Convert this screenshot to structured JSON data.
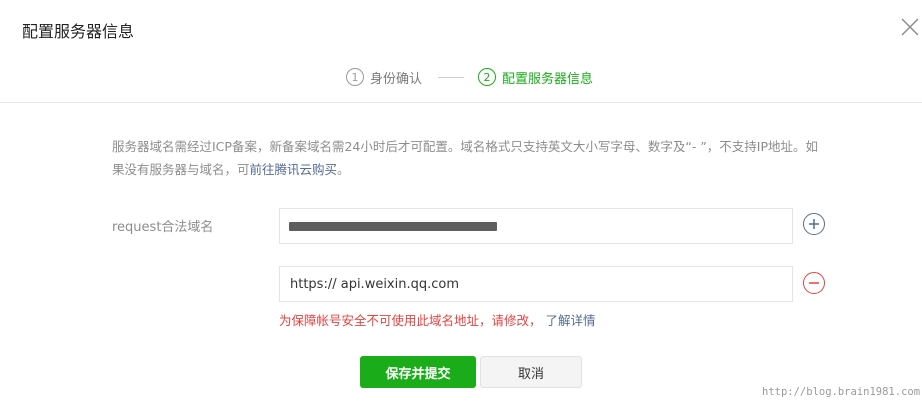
{
  "dialog": {
    "title": "配置服务器信息"
  },
  "steps": [
    {
      "number": "1",
      "label": "身份确认",
      "active": false
    },
    {
      "number": "2",
      "label": "配置服务器信息",
      "active": true
    }
  ],
  "tips": {
    "text_part1": "服务器域名需经过ICP备案，新备案域名需24小时后才可配置。域名格式只支持英文大小写字母、数字及“- ”，不支持IP地址。如果没有服务器与域名，可",
    "link": "前往腾讯云购买",
    "text_part2": "。"
  },
  "form": {
    "label": "request合法域名",
    "domains": [
      {
        "value": "",
        "redacted": true
      },
      {
        "value": "https:// api.weixin.qq.com"
      }
    ],
    "error": "为保障帐号安全不可使用此域名地址，请修改，",
    "error_link": "了解详情"
  },
  "buttons": {
    "submit": "保存并提交",
    "cancel": "取消"
  },
  "watermark": "http://blog.brain1981.com",
  "colors": {
    "primary": "#1aad19",
    "link": "#576b95",
    "error": "#e64340"
  },
  "icons": {
    "close": "close-icon",
    "add": "plus-icon",
    "remove": "minus-icon"
  }
}
